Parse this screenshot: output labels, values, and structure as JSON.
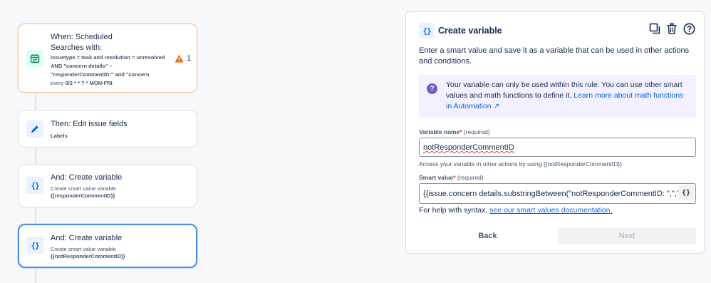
{
  "flow": {
    "trigger": {
      "title": "When: Scheduled",
      "searches_label": "Searches with:",
      "jql_line1": "issuetype = task and resolution = unresolved",
      "jql_line2": "AND \"concern details\" ~",
      "jql_line3": "\"responderCommentID:\" and \"concern",
      "schedule_prefix": "every",
      "schedule_value": "0/2 * * ? * MON-FRI",
      "warning_count": "1"
    },
    "edit": {
      "title": "Then: Edit issue fields",
      "subtitle": "Labels"
    },
    "create_var_1": {
      "title": "And: Create variable",
      "subtitle": "Create smart value variable",
      "variable": "{{responderCommentID}}"
    },
    "create_var_2": {
      "title": "And: Create variable",
      "subtitle": "Create smart value variable",
      "variable": "{{notResponderCommentID}}"
    }
  },
  "panel": {
    "title": "Create variable",
    "description": "Enter a smart value and save it as a variable that can be used in other actions and conditions.",
    "info_text": "Your variable can only be used within this rule. You can use other smart values and math functions to define it.",
    "info_link": "Learn more about math functions in Automation ↗",
    "variable_name_label": "Variable name",
    "required_text": "(required)",
    "variable_name_value": "notResponderCommentID",
    "variable_hint": "Access your variable in other actions by using {{notResponderCommentID}}",
    "smart_value_label": "Smart value",
    "smart_value_value": "{{issue.concern details.substringBetween(\"notResponderCommentID: \",\",\")}}",
    "brace_button": "{}",
    "help_prefix": "For help with syntax,",
    "help_link": "see our smart values documentation.",
    "back_label": "Back",
    "next_label": "Next"
  },
  "icons": {
    "header": [
      "copy-icon",
      "trash-icon",
      "help-icon"
    ],
    "calendar_color": "#1f845a",
    "warning_color": "#e56910",
    "accent": "#0c66e4",
    "info_icon_color": "#6e5dc6"
  }
}
